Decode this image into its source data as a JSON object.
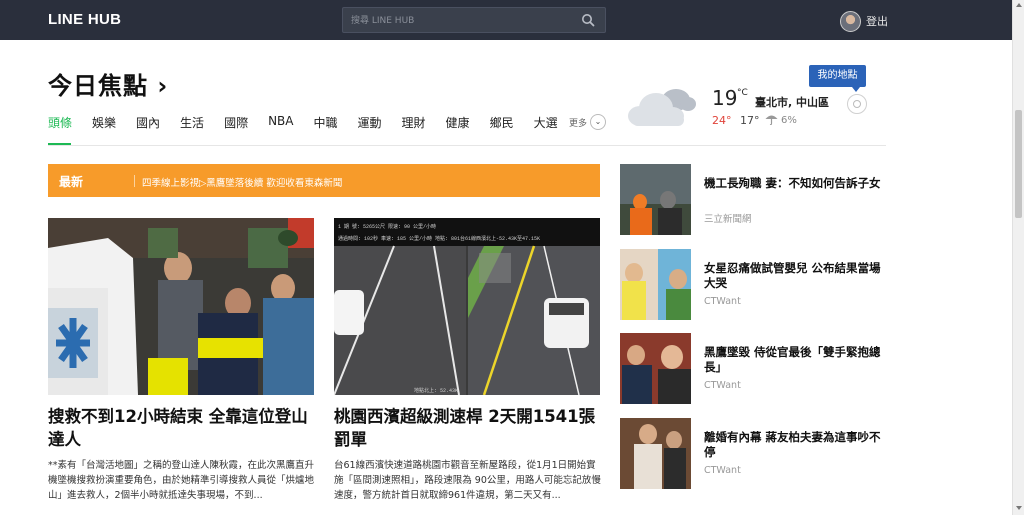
{
  "header": {
    "brand": "LINE HUB",
    "search_placeholder": "搜尋 LINE HUB",
    "logout": "登出"
  },
  "page_title": "今日焦點 ›",
  "tabs": [
    {
      "label": "頭條",
      "active": true
    },
    {
      "label": "娛樂"
    },
    {
      "label": "國內"
    },
    {
      "label": "生活"
    },
    {
      "label": "國際"
    },
    {
      "label": "NBA"
    },
    {
      "label": "中職"
    },
    {
      "label": "運動"
    },
    {
      "label": "理財"
    },
    {
      "label": "健康"
    },
    {
      "label": "鄉民"
    },
    {
      "label": "大選"
    }
  ],
  "more_label": "更多",
  "weather": {
    "temp": "19",
    "unit": "°C",
    "city": "臺北市, 中山區",
    "high": "24°",
    "low": "17°",
    "rain": "6%",
    "my_location": "我的地點"
  },
  "banner": {
    "tag": "最新",
    "text": "四季線上影視▷黑鷹墜落後續 歡迎收看東森新聞"
  },
  "main_articles": [
    {
      "title": "搜救不到12小時結束 全靠這位登山達人",
      "desc": "**素有「台灣活地圖」之稱的登山達人陳秋霞，在此次黑鷹直升機墜機搜救扮演重要角色，由於她精準引導搜救人員從「烘爐地山」進去救人，2個半小時就抵達失事現場，不到..."
    },
    {
      "title": "桃園西濱超級測速桿 2天開1541張罰單",
      "desc": "台61線西濱快速道路桃園市觀音至新屋路段，從1月1日開始實施「區間測速照相」，路段速限為 90公里，用路人可能忘記放慢速度，警方統計首日就取締961件違規，第二天又有..."
    }
  ],
  "speed_overlay": {
    "row1": "1  期  號: 5265公尺    限速: 90 公里/小時",
    "row2": "通過時間: 102秒    車速: 185 公里/小時   地點: 801台61線西濱北上-52.43K至47.15K",
    "stamp": "地點北上: 52.43K"
  },
  "side_articles": [
    {
      "title": "機工長殉職 妻：不知如何告訴子女",
      "source": "三立新聞網"
    },
    {
      "title": "女星忍痛做試管嬰兒 公布結果當場大哭",
      "source": "CTWant"
    },
    {
      "title": "黑鷹墜毀 侍從官最後「雙手緊抱總長」",
      "source": "CTWant"
    },
    {
      "title": "離婚有內幕 蔣友柏夫妻為這事吵不停",
      "source": "CTWant"
    }
  ],
  "colors": {
    "topbar": "#2a2f3c",
    "accent_green": "#1db954",
    "banner_orange": "#f79b2a",
    "location_blue": "#2b63b8",
    "high_temp_red": "#e0433a"
  }
}
